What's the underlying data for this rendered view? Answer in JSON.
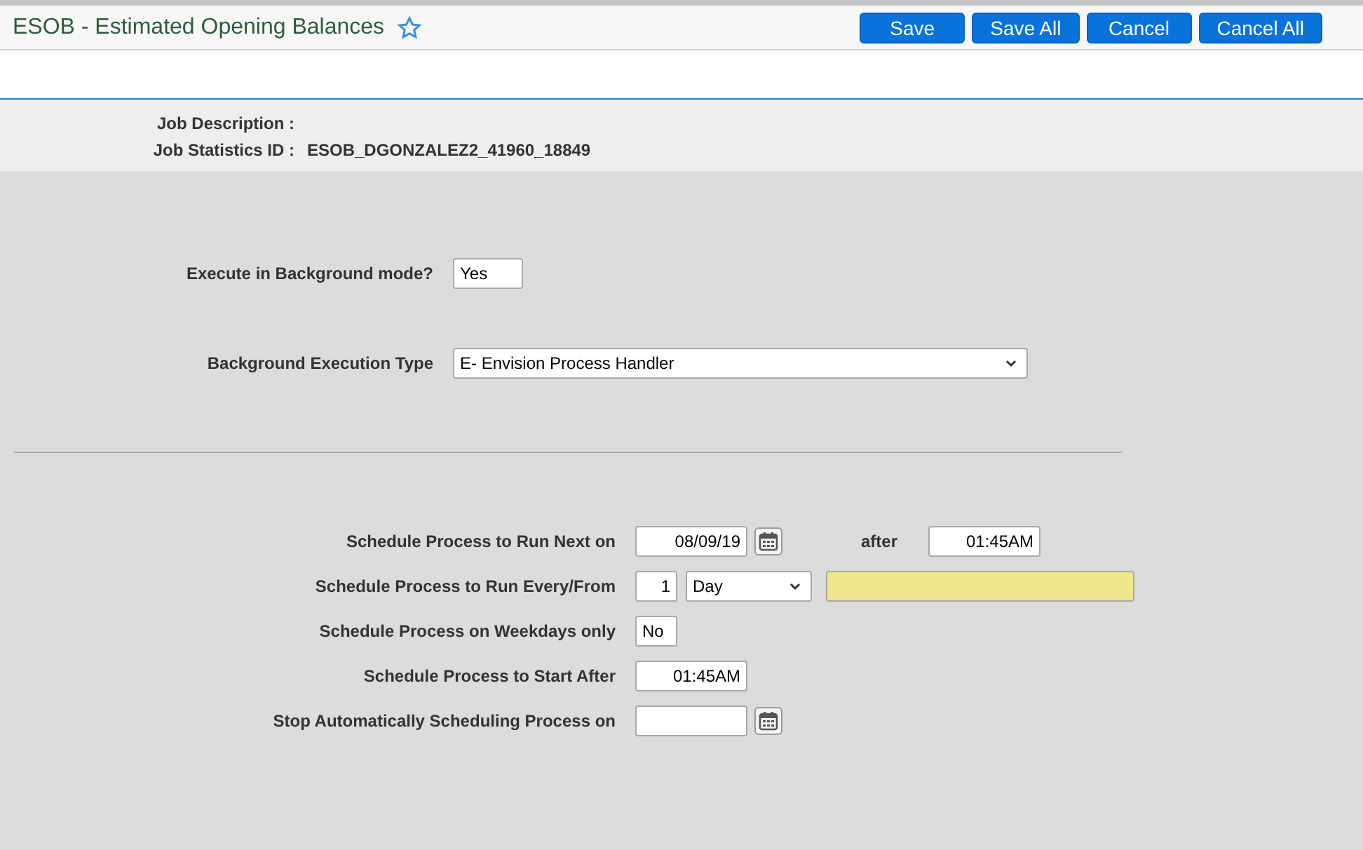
{
  "window": {
    "title": "ESOB - Estimated Opening Balances",
    "favorite": false
  },
  "buttons": [
    "Save",
    "Save All",
    "Cancel",
    "Cancel All"
  ],
  "job_info": [
    {
      "label": "Job Description :"
    },
    {
      "label": "Job Statistics ID :",
      "value": "ESOB_DGONZALEZ2_41960_18849"
    }
  ],
  "background": [
    {
      "label": "Execute in Background mode?",
      "controls": [
        {
          "kind": "flag",
          "value": "Yes"
        }
      ]
    },
    {
      "label": "Background Execution Type",
      "controls": [
        {
          "kind": "select",
          "value": "E- Envision Process Handler"
        }
      ]
    }
  ],
  "schedule": [
    {
      "label": "Schedule Process to Run Next on",
      "controls": [
        {
          "kind": "date",
          "value": "08/09/19"
        },
        {
          "kind": "calendar"
        },
        {
          "kind": "caption",
          "value": "after"
        },
        {
          "kind": "time",
          "value": "01:45AM"
        }
      ]
    },
    {
      "label": "Schedule Process to Run Every/From",
      "controls": [
        {
          "kind": "number",
          "value": "1"
        },
        {
          "kind": "select",
          "value": "Day"
        },
        {
          "kind": "note"
        }
      ]
    },
    {
      "label": "Schedule Process on Weekdays only",
      "controls": [
        {
          "kind": "flag",
          "value": "No"
        }
      ]
    },
    {
      "label": "Schedule Process to Start After",
      "controls": [
        {
          "kind": "time",
          "value": "01:45AM"
        }
      ]
    },
    {
      "label": "Stop Automatically Scheduling Process on",
      "controls": [
        {
          "kind": "date"
        },
        {
          "kind": "calendar"
        }
      ]
    }
  ]
}
